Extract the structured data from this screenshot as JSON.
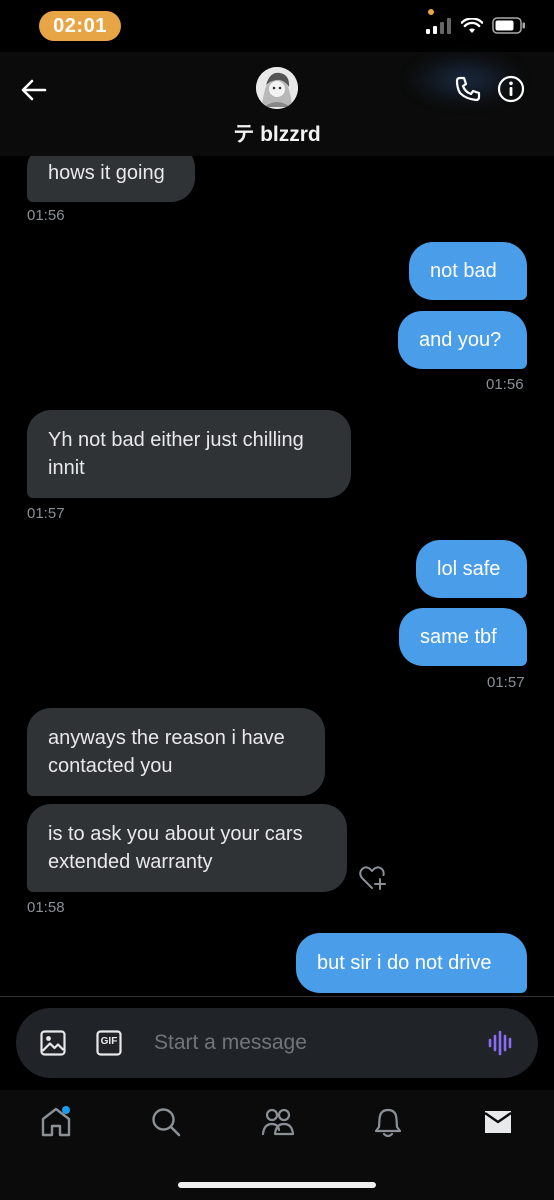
{
  "status_bar": {
    "time": "02:01"
  },
  "header": {
    "contact_name": "テ blzzrd"
  },
  "messages": [
    {
      "dir": "in",
      "text": "hows it going"
    },
    {
      "dir": "in-ts",
      "text": "01:56"
    },
    {
      "dir": "out",
      "text": "not bad"
    },
    {
      "dir": "out",
      "text": "and you?"
    },
    {
      "dir": "out-ts",
      "text": "01:56"
    },
    {
      "dir": "in",
      "text": "Yh not bad either just chilling innit"
    },
    {
      "dir": "in-ts",
      "text": "01:57"
    },
    {
      "dir": "out",
      "text": "lol safe"
    },
    {
      "dir": "out",
      "text": "same tbf"
    },
    {
      "dir": "out-ts",
      "text": "01:57"
    },
    {
      "dir": "in",
      "text": "anyways the reason i have contacted you"
    },
    {
      "dir": "in",
      "text": "is to ask you about your cars extended warranty"
    },
    {
      "dir": "in-ts",
      "text": "01:58"
    },
    {
      "dir": "out",
      "text": "but sir i do not drive"
    }
  ],
  "composer": {
    "placeholder": "Start a message",
    "gif_label": "GIF"
  },
  "colors": {
    "accent": "#1d9bf0",
    "incoming_bubble": "#2f3336",
    "outgoing_bubble": "#4a9de8",
    "time_pill": "#e8a546",
    "voice_icon": "#8b6cf6"
  },
  "icons": {
    "header": [
      "back-arrow-icon",
      "call-icon",
      "info-icon"
    ],
    "composer": [
      "image-icon",
      "gif-icon",
      "voice-icon"
    ],
    "nav": [
      "home-icon",
      "search-icon",
      "communities-icon",
      "notifications-icon",
      "messages-icon"
    ]
  }
}
